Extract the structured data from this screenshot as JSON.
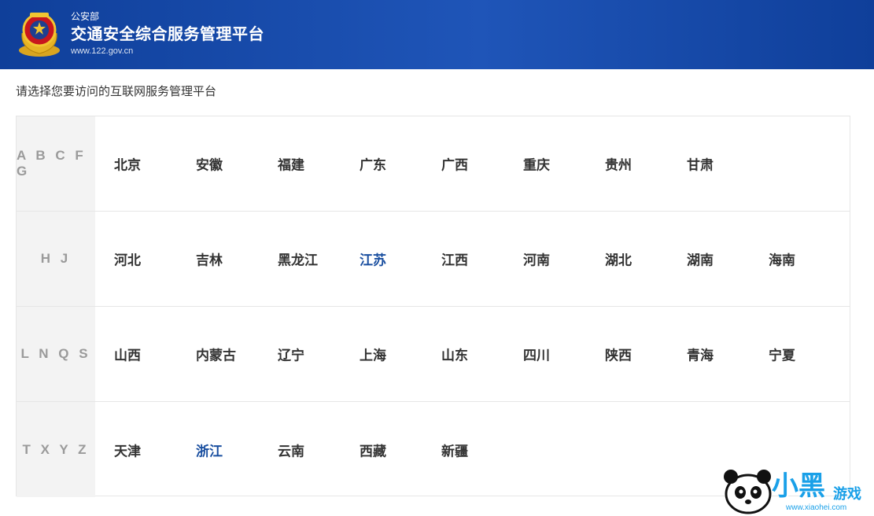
{
  "header": {
    "department": "公安部",
    "title": "交通安全综合服务管理平台",
    "url": "www.122.gov.cn"
  },
  "instruction": "请选择您要访问的互联网服务管理平台",
  "rows": [
    {
      "label": "A B C F G",
      "provinces": [
        "北京",
        "安徽",
        "福建",
        "广东",
        "广西",
        "重庆",
        "贵州",
        "甘肃"
      ]
    },
    {
      "label": "H J",
      "provinces": [
        "河北",
        "吉林",
        "黑龙江",
        "江苏",
        "江西",
        "河南",
        "湖北",
        "湖南",
        "海南"
      ]
    },
    {
      "label": "L N Q S",
      "provinces": [
        "山西",
        "内蒙古",
        "辽宁",
        "上海",
        "山东",
        "四川",
        "陕西",
        "青海",
        "宁夏"
      ]
    },
    {
      "label": "T X Y Z",
      "provinces": [
        "天津",
        "浙江",
        "云南",
        "西藏",
        "新疆"
      ]
    }
  ],
  "highlighted": [
    "江苏",
    "浙江"
  ],
  "colors": {
    "header_bg": "#1f55b8",
    "highlight": "#1a4fa0",
    "text": "#333333",
    "label_bg": "#f3f3f3"
  },
  "watermark": {
    "logo_text": "小黑",
    "suffix": "游戏",
    "url": "www.xiaohei.com"
  }
}
